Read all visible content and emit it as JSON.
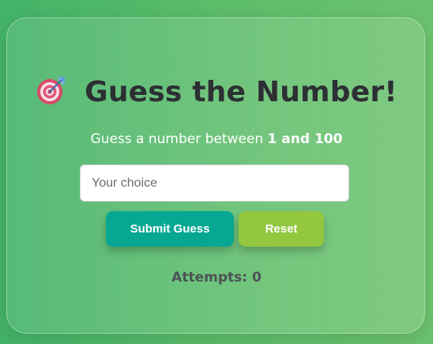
{
  "game": {
    "title": "Guess the Number!",
    "title_icon": "direct-hit-target-icon",
    "instruction_prefix": "Guess a number between",
    "instruction_range": "1 and 100",
    "attempts_label": "Attempts:",
    "attempts_count": "0"
  },
  "input": {
    "placeholder": "Your choice",
    "value": ""
  },
  "buttons": {
    "submit_label": "Submit Guess",
    "reset_label": "Reset"
  },
  "colors": {
    "background_start": "#43b368",
    "background_end": "#6cc26e",
    "submit_button": "#07a893",
    "reset_button": "#93c73e",
    "title_text": "#2c2f33"
  }
}
